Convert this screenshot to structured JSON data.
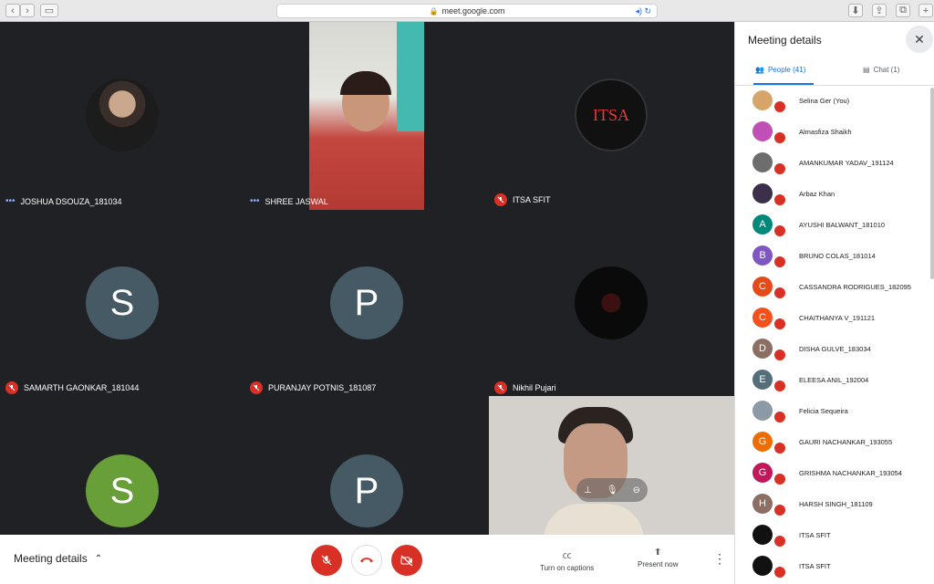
{
  "browser": {
    "url": "meet.google.com"
  },
  "tiles": [
    {
      "name": "JOSHUA DSOUZA_181034",
      "status": "talking",
      "avatar_letter": "",
      "avatar_color": "#b0b0b0"
    },
    {
      "name": "SHREE JASWAL",
      "status": "talking",
      "avatar_letter": "",
      "avatar_color": ""
    },
    {
      "name": "ITSA SFIT",
      "status": "muted",
      "avatar_letter": "",
      "avatar_color": "#111"
    },
    {
      "name": "SAMARTH GAONKAR_181044",
      "status": "muted",
      "avatar_letter": "S",
      "avatar_color": "#455a64"
    },
    {
      "name": "PURANJAY POTNIS_181087",
      "status": "muted",
      "avatar_letter": "P",
      "avatar_color": "#455a64"
    },
    {
      "name": "Nikhil Pujari",
      "status": "muted",
      "avatar_letter": "",
      "avatar_color": "#000"
    },
    {
      "name": "",
      "status": "",
      "avatar_letter": "S",
      "avatar_color": "#689f38"
    },
    {
      "name": "",
      "status": "",
      "avatar_letter": "P",
      "avatar_color": "#455a64"
    }
  ],
  "bottom_bar": {
    "meeting_details": "Meeting details",
    "captions_label": "Turn on captions",
    "present_label": "Present now"
  },
  "panel": {
    "title": "Meeting details",
    "tab_people": "People (41)",
    "tab_chat": "Chat (1)",
    "people": [
      {
        "name": "Selina Ger (You)",
        "letter": "",
        "color": "#d7a56a"
      },
      {
        "name": "Almasfiza Shaikh",
        "letter": "",
        "color": "#c04fb6"
      },
      {
        "name": "AMANKUMAR YADAV_191124",
        "letter": "",
        "color": "#6d6d6d"
      },
      {
        "name": "Arbaz Khan",
        "letter": "",
        "color": "#3b2f4a"
      },
      {
        "name": "AYUSHI BALWANT_181010",
        "letter": "A",
        "color": "#00897b"
      },
      {
        "name": "BRUNO COLAS_181014",
        "letter": "B",
        "color": "#7e57c2"
      },
      {
        "name": "CASSANDRA RODRIGUES_182095",
        "letter": "C",
        "color": "#e64a19"
      },
      {
        "name": "CHAITHANYA V_191121",
        "letter": "C",
        "color": "#f4511e"
      },
      {
        "name": "DISHA GULVE_183034",
        "letter": "D",
        "color": "#8d6e63"
      },
      {
        "name": "ELEESA ANIL_192004",
        "letter": "E",
        "color": "#546e7a"
      },
      {
        "name": "Felicia Sequeira",
        "letter": "",
        "color": "#8c9aa5"
      },
      {
        "name": "GAURI NACHANKAR_193055",
        "letter": "G",
        "color": "#ef6c00"
      },
      {
        "name": "GRISHMA NACHANKAR_193054",
        "letter": "G",
        "color": "#c2185b"
      },
      {
        "name": "HARSH SINGH_181109",
        "letter": "H",
        "color": "#8d6e63"
      },
      {
        "name": "ITSA SFIT",
        "letter": "",
        "color": "#111111"
      },
      {
        "name": "ITSA SFIT",
        "letter": "",
        "color": "#111111"
      }
    ]
  },
  "colors": {
    "accent": "#1a73e8",
    "danger": "#d93025",
    "stage": "#202124"
  }
}
